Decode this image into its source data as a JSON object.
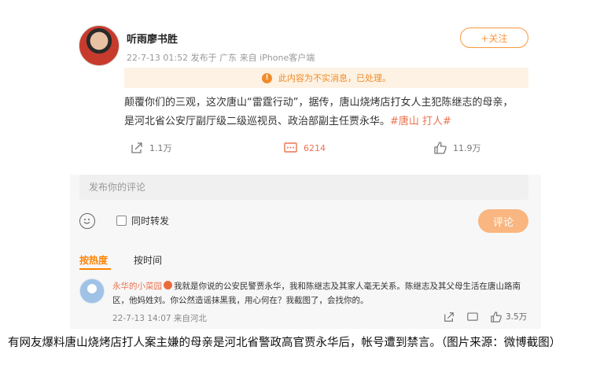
{
  "post": {
    "username": "听雨廖书胜",
    "meta": "22-7-13 01:52  发布于 广东  来自 iPhone客户端",
    "follow_label": "+关注",
    "notice": "此内容为不实消息，已处理。",
    "text": "颠覆你们的三观，这次唐山“雷霆行动”，据传，唐山烧烤店打女人主犯陈继志的母亲，是河北省公安厅副厅级二级巡视员、政治部副主任贾永华。",
    "hashtag": "#唐山 打人#",
    "shares": "1.1万",
    "comments": "6214",
    "likes": "11.9万"
  },
  "composer": {
    "placeholder": "发布你的评论",
    "repost_label": "同时转发",
    "submit_label": "评论"
  },
  "tabs": {
    "hot": "按热度",
    "time": "按时间"
  },
  "comment": {
    "user": "永华的小菜园",
    "text": "我就是你说的公安民警贾永华，我和陈继志及其家人毫无关系。陈继志及其父母生活在唐山路南区，他妈姓刘。你公然造谣抹黑我，用心何在？我截图了，会找你的。",
    "meta": "22-7-13 14:07  来自河北",
    "likes": "3.5万"
  },
  "caption": "有网友爆料唐山烧烤店打人案主嫌的母亲是河北省警政高官贾永华后，帐号遭到禁言。（图片来源：微博截图）",
  "colors": {
    "accent": "#ff8200",
    "follow": "#f8993d",
    "notice_bg": "#fdf2e3",
    "hashtag": "#eb7350",
    "submit_bg": "#f9b680"
  }
}
